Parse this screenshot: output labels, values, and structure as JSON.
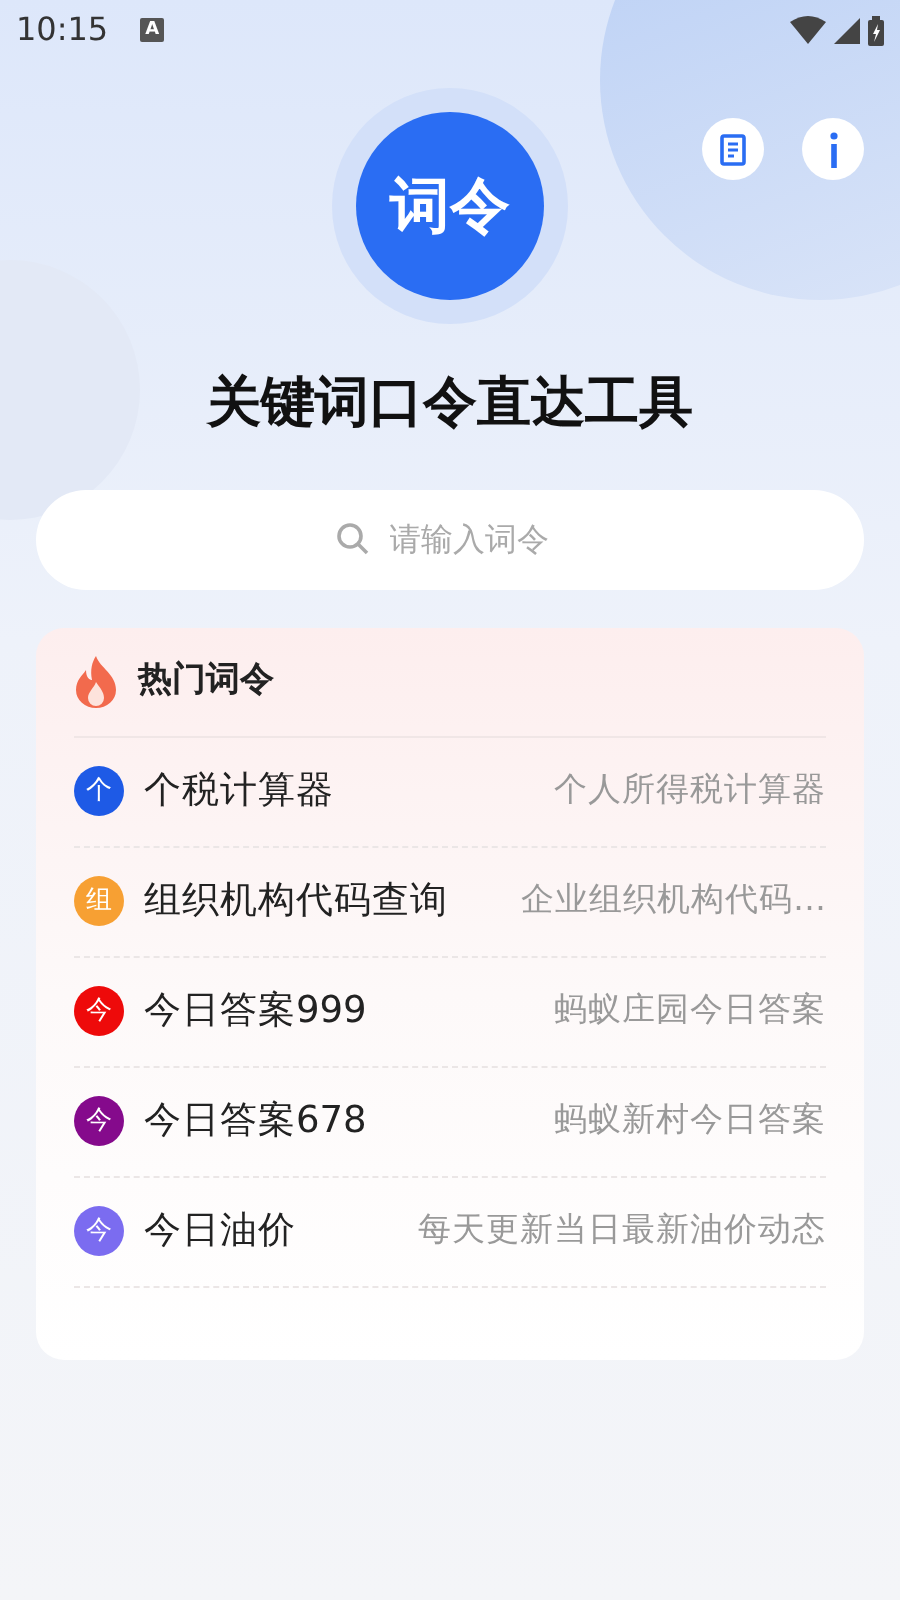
{
  "status_bar": {
    "time": "10:15",
    "notification_icon": "A"
  },
  "header": {
    "logo_text": "词令",
    "title": "关键词口令直达工具"
  },
  "search": {
    "placeholder": "请输入词令"
  },
  "hot_list": {
    "title": "热门词令",
    "items": [
      {
        "badge": "个",
        "color": "#1e5ae6",
        "name": "个税计算器",
        "description": "个人所得税计算器"
      },
      {
        "badge": "组",
        "color": "#f7a033",
        "name": "组织机构代码查询",
        "description": "企业组织机构代码…"
      },
      {
        "badge": "今",
        "color": "#ee0a0a",
        "name": "今日答案999",
        "description": "蚂蚁庄园今日答案"
      },
      {
        "badge": "今",
        "color": "#850a8c",
        "name": "今日答案678",
        "description": "蚂蚁新村今日答案"
      },
      {
        "badge": "今",
        "color": "#7b6cf0",
        "name": "今日油价",
        "description": "每天更新当日最新油价动态"
      }
    ]
  }
}
